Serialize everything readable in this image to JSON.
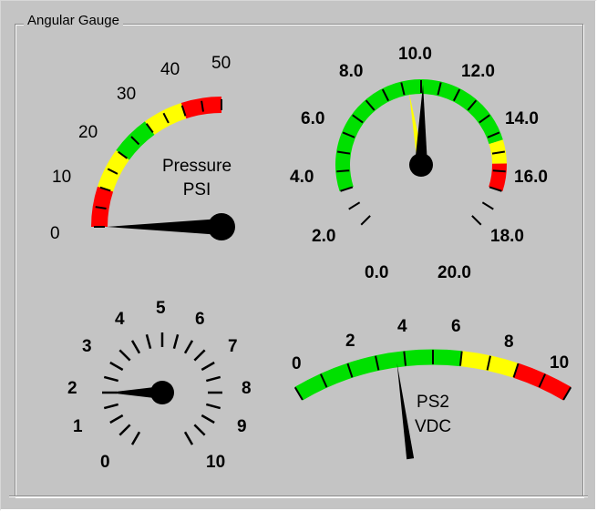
{
  "groupbox": {
    "title": "Angular Gauge"
  },
  "gauges": {
    "pressure": {
      "labels": [
        "0",
        "10",
        "20",
        "30",
        "40",
        "50"
      ],
      "title_line1": "Pressure",
      "title_line2": "PSI",
      "min": 0,
      "max": 50,
      "value": 0,
      "zones": [
        {
          "from": 0,
          "to": 10,
          "color": "#ff0000"
        },
        {
          "from": 10,
          "to": 20,
          "color": "#ffff00"
        },
        {
          "from": 20,
          "to": 30,
          "color": "#00e000"
        },
        {
          "from": 30,
          "to": 40,
          "color": "#ffff00"
        },
        {
          "from": 40,
          "to": 50,
          "color": "#ff0000"
        }
      ]
    },
    "dial": {
      "labels": [
        "0.0",
        "2.0",
        "4.0",
        "6.0",
        "8.0",
        "10.0",
        "12.0",
        "14.0",
        "16.0",
        "18.0",
        "20.0"
      ],
      "min": 0,
      "max": 20,
      "value": 10.1,
      "secondary_value": 9.3,
      "zones": [
        {
          "from": 2,
          "to": 15.4,
          "color": "#00e000"
        },
        {
          "from": 15.4,
          "to": 16.6,
          "color": "#ffff00"
        },
        {
          "from": 16.6,
          "to": 18,
          "color": "#ff0000"
        }
      ]
    },
    "ticks": {
      "labels": [
        "0",
        "1",
        "2",
        "3",
        "4",
        "5",
        "6",
        "7",
        "8",
        "9",
        "10"
      ],
      "min": 0,
      "max": 10,
      "value": 2
    },
    "ps2": {
      "labels": [
        "0",
        "2",
        "4",
        "6",
        "8",
        "10"
      ],
      "title_line1": "PS2",
      "title_line2": "VDC",
      "min": 0,
      "max": 10,
      "value": 3.7,
      "zones": [
        {
          "from": 0,
          "to": 6,
          "color": "#00e000"
        },
        {
          "from": 6,
          "to": 8,
          "color": "#ffff00"
        },
        {
          "from": 8,
          "to": 10,
          "color": "#ff0000"
        }
      ]
    }
  }
}
